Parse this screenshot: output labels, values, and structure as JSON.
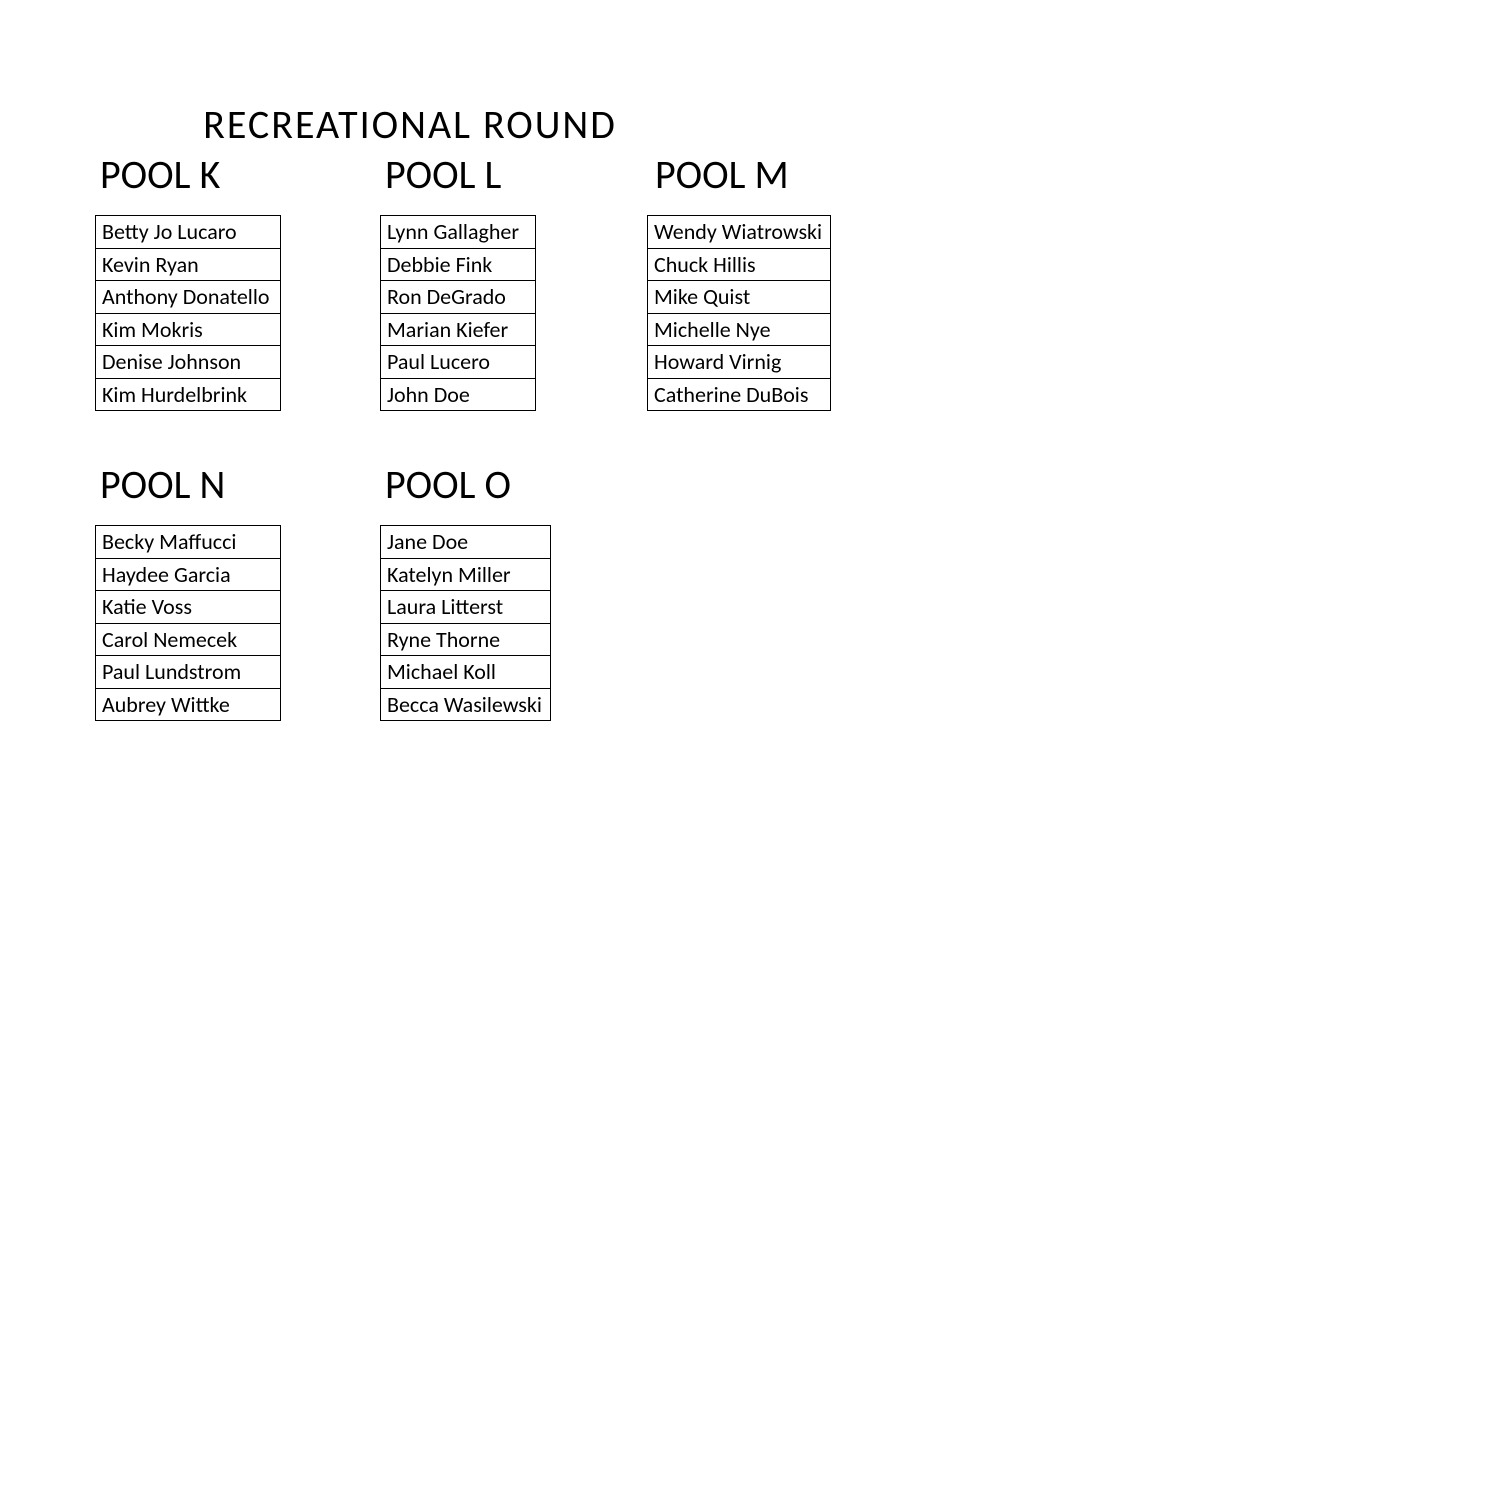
{
  "title": "RECREATIONAL   ROUND",
  "pools": [
    {
      "label": "POOL K",
      "members": [
        "Betty Jo Lucaro",
        "Kevin Ryan",
        "Anthony Donatello",
        "Kim Mokris",
        "Denise Johnson",
        "Kim Hurdelbrink"
      ]
    },
    {
      "label": "POOL L",
      "members": [
        "Lynn Gallagher",
        "Debbie Fink",
        "Ron DeGrado",
        "Marian Kiefer",
        "Paul Lucero",
        "John Doe"
      ]
    },
    {
      "label": "POOL M",
      "members": [
        "Wendy Wiatrowski",
        "Chuck Hillis",
        "Mike Quist",
        "Michelle Nye",
        "Howard Virnig",
        "Catherine DuBois"
      ]
    },
    {
      "label": "POOL N",
      "members": [
        "Becky Maffucci",
        "Haydee Garcia",
        "Katie Voss",
        "Carol Nemecek",
        "Paul Lundstrom",
        "Aubrey Wittke"
      ]
    },
    {
      "label": "POOL O",
      "members": [
        "Jane Doe",
        "Katelyn Miller",
        "Laura Litterst",
        "Ryne Thorne",
        "Michael Koll",
        "Becca Wasilewski"
      ]
    }
  ]
}
